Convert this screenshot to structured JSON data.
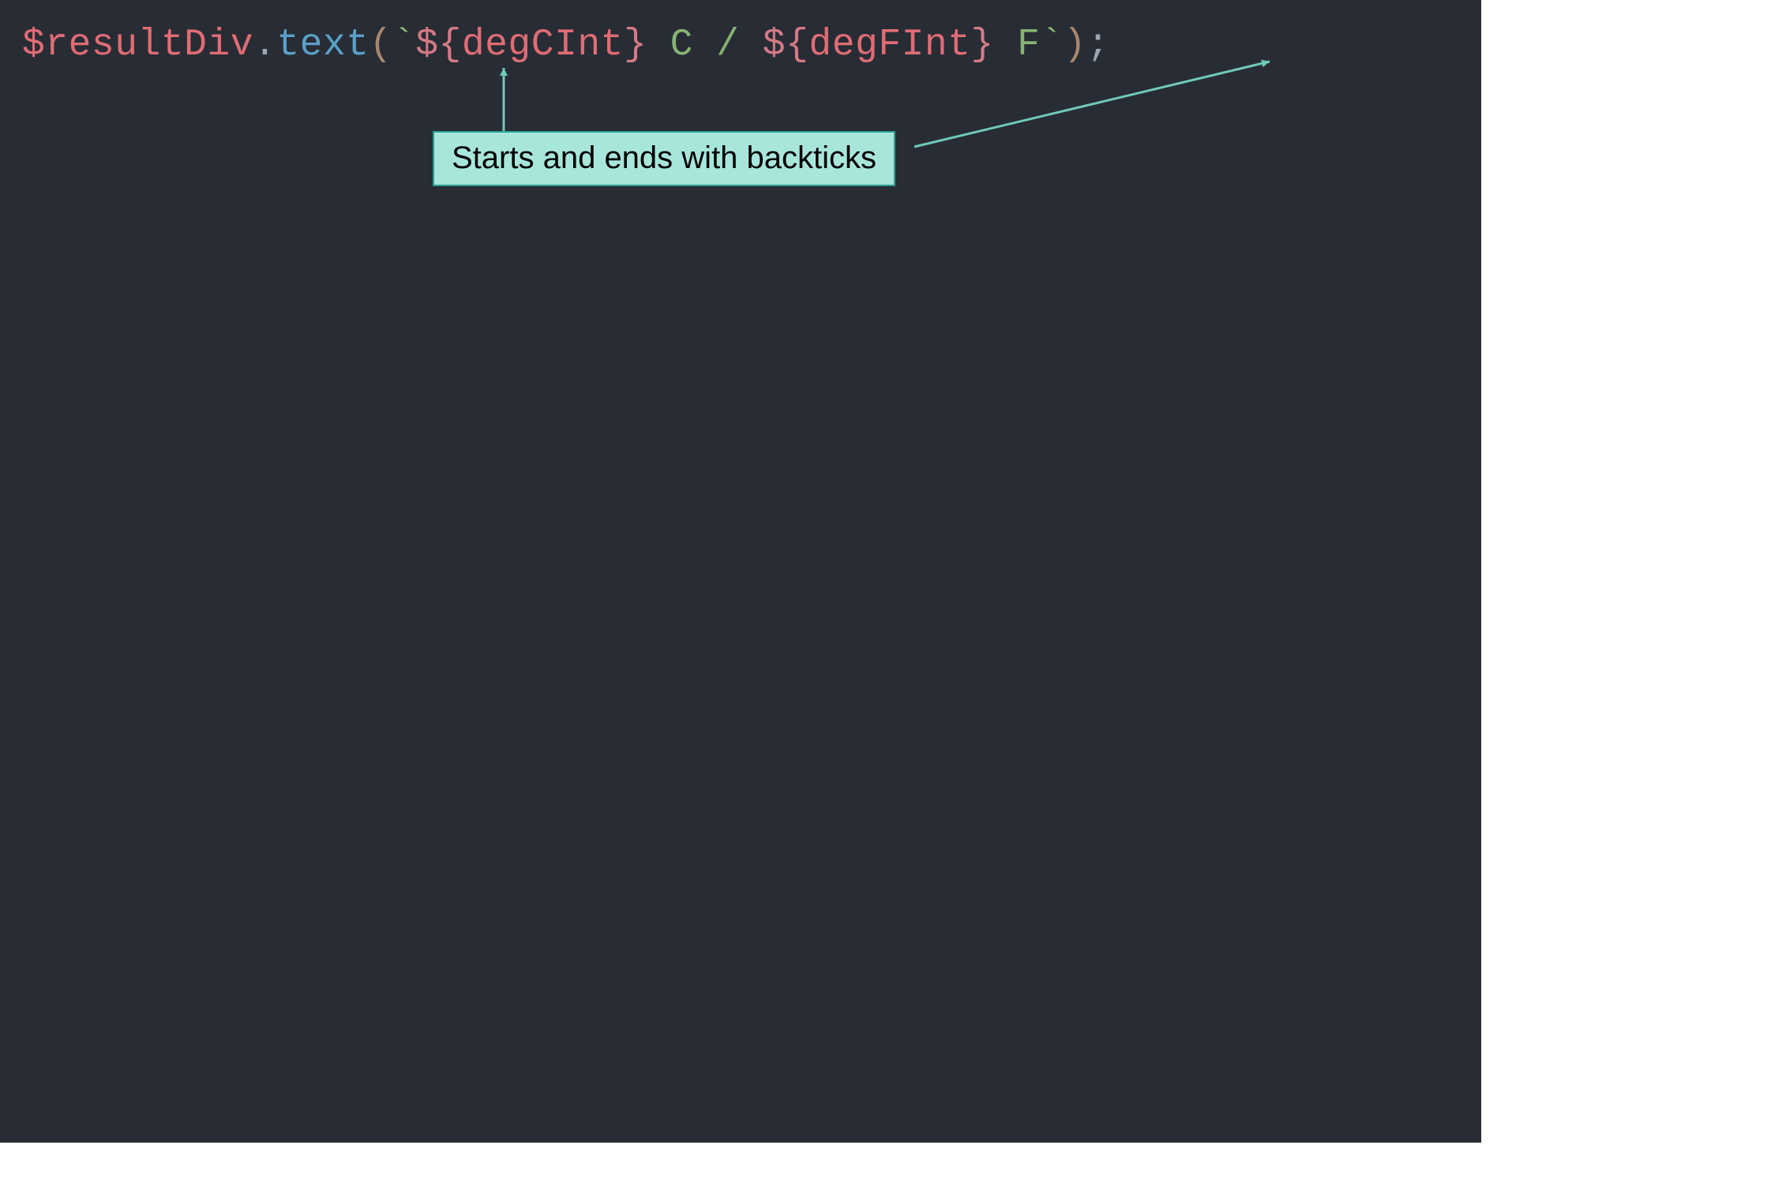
{
  "code": {
    "t1": "$resultDiv",
    "t2": ".",
    "t3": "text",
    "t4": "(",
    "t5": "`",
    "t6": "${",
    "t7": "degCInt",
    "t8": "}",
    "t9": " C / ",
    "t10": "${",
    "t11": "degFInt",
    "t12": "}",
    "t13": " F",
    "t14": "`",
    "t15": ")",
    "t16": ";"
  },
  "callout": {
    "text": "Starts and ends with backticks"
  },
  "colors": {
    "editor_bg": "#282c34",
    "callout_bg": "#a8e6dc",
    "callout_border": "#2a9d8f",
    "arrow": "#6fc9bb"
  }
}
